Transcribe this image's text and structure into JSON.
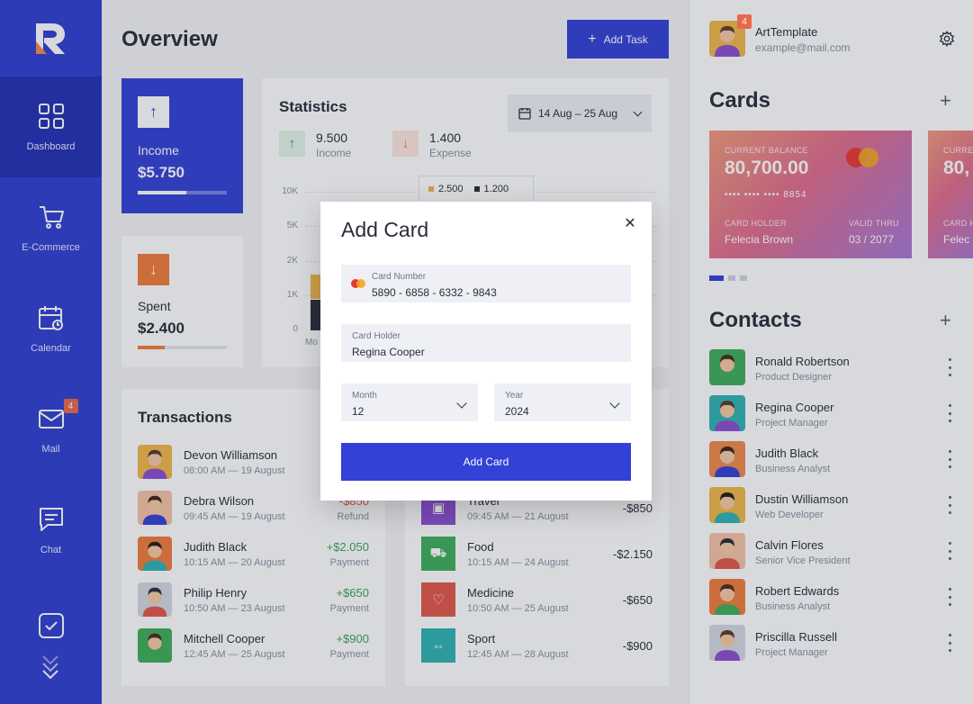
{
  "sidebar": {
    "items": [
      {
        "label": "Dashboard",
        "icon": "grid-icon"
      },
      {
        "label": "E-Commerce",
        "icon": "cart-icon"
      },
      {
        "label": "Calendar",
        "icon": "calendar-icon"
      },
      {
        "label": "Mail",
        "icon": "mail-icon",
        "badge": "4"
      },
      {
        "label": "Chat",
        "icon": "chat-icon"
      }
    ]
  },
  "header": {
    "title": "Overview",
    "add_task": "Add Task"
  },
  "income": {
    "label": "Income",
    "value": "$5.750",
    "progress": 0.55
  },
  "spent": {
    "label": "Spent",
    "value": "$2.400",
    "progress": 0.3
  },
  "statistics": {
    "title": "Statistics",
    "date_range": "14 Aug – 25 Aug",
    "income_value": "9.500",
    "income_label": "Income",
    "expense_value": "1.400",
    "expense_label": "Expense",
    "tooltip_income": "2.500",
    "tooltip_expense": "1.200"
  },
  "chart_data": {
    "type": "bar",
    "categories": [
      "Mo"
    ],
    "series": [
      {
        "name": "Income",
        "values": [
          2500
        ]
      },
      {
        "name": "Expense",
        "values": [
          1200
        ]
      }
    ],
    "ylim": [
      0,
      10000
    ],
    "yticks": [
      "10K",
      "5K",
      "2K",
      "1K",
      "0"
    ]
  },
  "transactions": {
    "title": "Transactions",
    "rows": [
      {
        "name": "Devon Williamson",
        "date": "08:00 AM — 19 August",
        "amount": "",
        "kind": ""
      },
      {
        "name": "Debra Wilson",
        "date": "09:45 AM — 19 August",
        "amount": "-$850",
        "kind": "Refund"
      },
      {
        "name": "Judith Black",
        "date": "10:15 AM — 20 August",
        "amount": "+$2.050",
        "kind": "Payment"
      },
      {
        "name": "Philip Henry",
        "date": "10:50 AM — 23 August",
        "amount": "+$650",
        "kind": "Payment"
      },
      {
        "name": "Mitchell Cooper",
        "date": "12:45 AM — 25 August",
        "amount": "+$900",
        "kind": "Payment"
      }
    ]
  },
  "expenses": {
    "rows": [
      {
        "name": "Travel",
        "date": "09:45 AM — 21 August",
        "amount": "-$850",
        "icon": "suitcase-icon",
        "color": "#8b4fd1"
      },
      {
        "name": "Food",
        "date": "10:15 AM — 24 August",
        "amount": "-$2.150",
        "icon": "cart-icon",
        "color": "#3fae5b"
      },
      {
        "name": "Medicine",
        "date": "10:50 AM — 25 August",
        "amount": "-$650",
        "icon": "heart-icon",
        "color": "#e2584a"
      },
      {
        "name": "Sport",
        "date": "12:45 AM — 28 August",
        "amount": "-$900",
        "icon": "dumbbell-icon",
        "color": "#2fb3b3"
      }
    ]
  },
  "profile": {
    "name": "ArtTemplate",
    "email": "example@mail.com",
    "badge": "4"
  },
  "cards": {
    "title": "Cards",
    "card": {
      "balance_label": "CURRENT BALANCE",
      "balance": "80,700.00",
      "number": "•••• •••• •••• 8854",
      "holder_label": "CARD HOLDER",
      "holder": "Felecia Brown",
      "valid_label": "VALID THRU",
      "valid": "03 / 2077"
    },
    "card2": {
      "balance_label": "CURRE",
      "balance": "80,",
      "holder_label": "CARD H",
      "holder": "Felec"
    }
  },
  "contacts": {
    "title": "Contacts",
    "items": [
      {
        "name": "Ronald Robertson",
        "role": "Product Designer"
      },
      {
        "name": "Regina Cooper",
        "role": "Project Manager"
      },
      {
        "name": "Judith Black",
        "role": "Business Analyst"
      },
      {
        "name": "Dustin Williamson",
        "role": "Web Developer"
      },
      {
        "name": "Calvin Flores",
        "role": "Senior Vice President"
      },
      {
        "name": "Robert Edwards",
        "role": "Business Analyst"
      },
      {
        "name": "Priscilla Russell",
        "role": "Project Manager"
      }
    ]
  },
  "modal": {
    "title": "Add Card",
    "card_number_label": "Card Number",
    "card_number": "5890 - 6858 - 6332 - 9843",
    "holder_label": "Card Holder",
    "holder": "Regina Cooper",
    "month_label": "Month",
    "month": "12",
    "year_label": "Year",
    "year": "2024",
    "submit": "Add Card"
  },
  "colors": {
    "primary": "#3341d6",
    "sidebar": "#2f3fd1",
    "positive": "#3aa655",
    "orange": "#ef7d3c"
  }
}
